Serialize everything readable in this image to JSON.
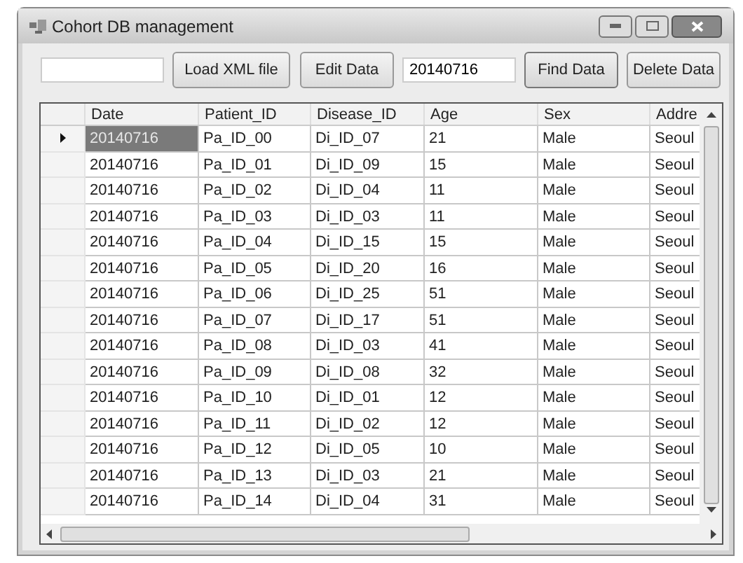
{
  "window": {
    "title": "Cohort DB management"
  },
  "toolbar": {
    "load_button": "Load XML file",
    "edit_button": "Edit Data",
    "date_field": {
      "value": "20140716"
    },
    "find_button": "Find Data",
    "delete_button": "Delete Data"
  },
  "table": {
    "columns": [
      "Date",
      "Patient_ID",
      "Disease_ID",
      "Age",
      "Sex",
      "Addre"
    ],
    "rows": [
      {
        "cells": [
          "20140716",
          "Pa_ID_00",
          "Di_ID_07",
          "21",
          "Male",
          "Seoul"
        ],
        "selected": true
      },
      {
        "cells": [
          "20140716",
          "Pa_ID_01",
          "Di_ID_09",
          "15",
          "Male",
          "Seoul"
        ],
        "selected": false
      },
      {
        "cells": [
          "20140716",
          "Pa_ID_02",
          "Di_ID_04",
          "11",
          "Male",
          "Seoul"
        ],
        "selected": false
      },
      {
        "cells": [
          "20140716",
          "Pa_ID_03",
          "Di_ID_03",
          "11",
          "Male",
          "Seoul"
        ],
        "selected": false
      },
      {
        "cells": [
          "20140716",
          "Pa_ID_04",
          "Di_ID_15",
          "15",
          "Male",
          "Seoul"
        ],
        "selected": false
      },
      {
        "cells": [
          "20140716",
          "Pa_ID_05",
          "Di_ID_20",
          "16",
          "Male",
          "Seoul"
        ],
        "selected": false
      },
      {
        "cells": [
          "20140716",
          "Pa_ID_06",
          "Di_ID_25",
          "51",
          "Male",
          "Seoul"
        ],
        "selected": false
      },
      {
        "cells": [
          "20140716",
          "Pa_ID_07",
          "Di_ID_17",
          "51",
          "Male",
          "Seoul"
        ],
        "selected": false
      },
      {
        "cells": [
          "20140716",
          "Pa_ID_08",
          "Di_ID_03",
          "41",
          "Male",
          "Seoul"
        ],
        "selected": false
      },
      {
        "cells": [
          "20140716",
          "Pa_ID_09",
          "Di_ID_08",
          "32",
          "Male",
          "Seoul"
        ],
        "selected": false
      },
      {
        "cells": [
          "20140716",
          "Pa_ID_10",
          "Di_ID_01",
          "12",
          "Male",
          "Seoul"
        ],
        "selected": false
      },
      {
        "cells": [
          "20140716",
          "Pa_ID_11",
          "Di_ID_02",
          "12",
          "Male",
          "Seoul"
        ],
        "selected": false
      },
      {
        "cells": [
          "20140716",
          "Pa_ID_12",
          "Di_ID_05",
          "10",
          "Male",
          "Seoul"
        ],
        "selected": false
      },
      {
        "cells": [
          "20140716",
          "Pa_ID_13",
          "Di_ID_03",
          "21",
          "Male",
          "Seoul"
        ],
        "selected": false
      },
      {
        "cells": [
          "20140716",
          "Pa_ID_14",
          "Di_ID_04",
          "31",
          "Male",
          "Seoul"
        ],
        "selected": false
      }
    ]
  }
}
